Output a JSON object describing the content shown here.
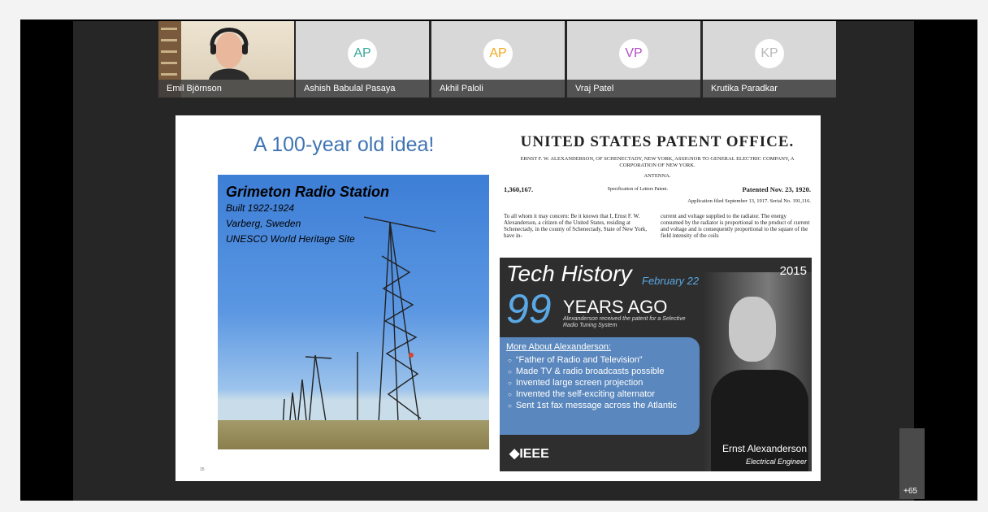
{
  "participants": [
    {
      "name": "Emil Björnson",
      "initials": ""
    },
    {
      "name": "Ashish Babulal Pasaya",
      "initials": "AP",
      "color": "#39a89a"
    },
    {
      "name": "Akhil Paloli",
      "initials": "AP",
      "color": "#f2a81d"
    },
    {
      "name": "Vraj Patel",
      "initials": "VP",
      "color": "#b14fc5"
    },
    {
      "name": "Krutika Paradkar",
      "initials": "KP",
      "color": "#b8b8b8"
    }
  ],
  "overflow_count": "+65",
  "slide": {
    "title": "A 100-year old idea!",
    "photo": {
      "heading": "Grimeton Radio Station",
      "lines": [
        "Built 1922-1924",
        "Varberg, Sweden",
        "UNESCO World Heritage Site"
      ]
    },
    "patent": {
      "title": "UNITED STATES PATENT OFFICE.",
      "assignor": "ERNST F. W. ALEXANDERSON, OF SCHENECTADY, NEW YORK, ASSIGNOR TO GENERAL ELECTRIC COMPANY, A CORPORATION OF NEW YORK.",
      "subject": "ANTENNA.",
      "number": "1,360,167.",
      "spec": "Specification of Letters Patent.",
      "patented": "Patented Nov. 23, 1920.",
      "application": "Application filed September 13, 1917. Serial No. 191,116.",
      "col_left": "To all whom it may concern: Be it known that I, Ernst F. W. Alexanderson, a citizen of the United States, residing at Schenectady, in the county of Schenectady, State of New York, have in-",
      "col_right": "current and voltage supplied to the radiator. The energy consumed by the radiator is proportional to the product of current and voltage and is consequently proportional to the square of the field intensity of the coils"
    },
    "tech_history": {
      "title": "Tech History",
      "date": "February 22",
      "year": "2015",
      "number": "99",
      "years_ago": "YEARS AGO",
      "subtitle": "Alexanderson received the patent for a Selective Radio Tuning System",
      "more_header": "More About Alexanderson:",
      "bullets": [
        "“Father of Radio and Television”",
        "Made TV & radio broadcasts possible",
        "Invented large screen projection",
        "Invented the self-exciting alternator",
        "Sent 1st fax message across the Atlantic"
      ],
      "logo": "IEEE",
      "caption_name": "Ernst Alexanderson",
      "caption_role": "Electrical Engineer"
    },
    "slide_number": "15"
  }
}
